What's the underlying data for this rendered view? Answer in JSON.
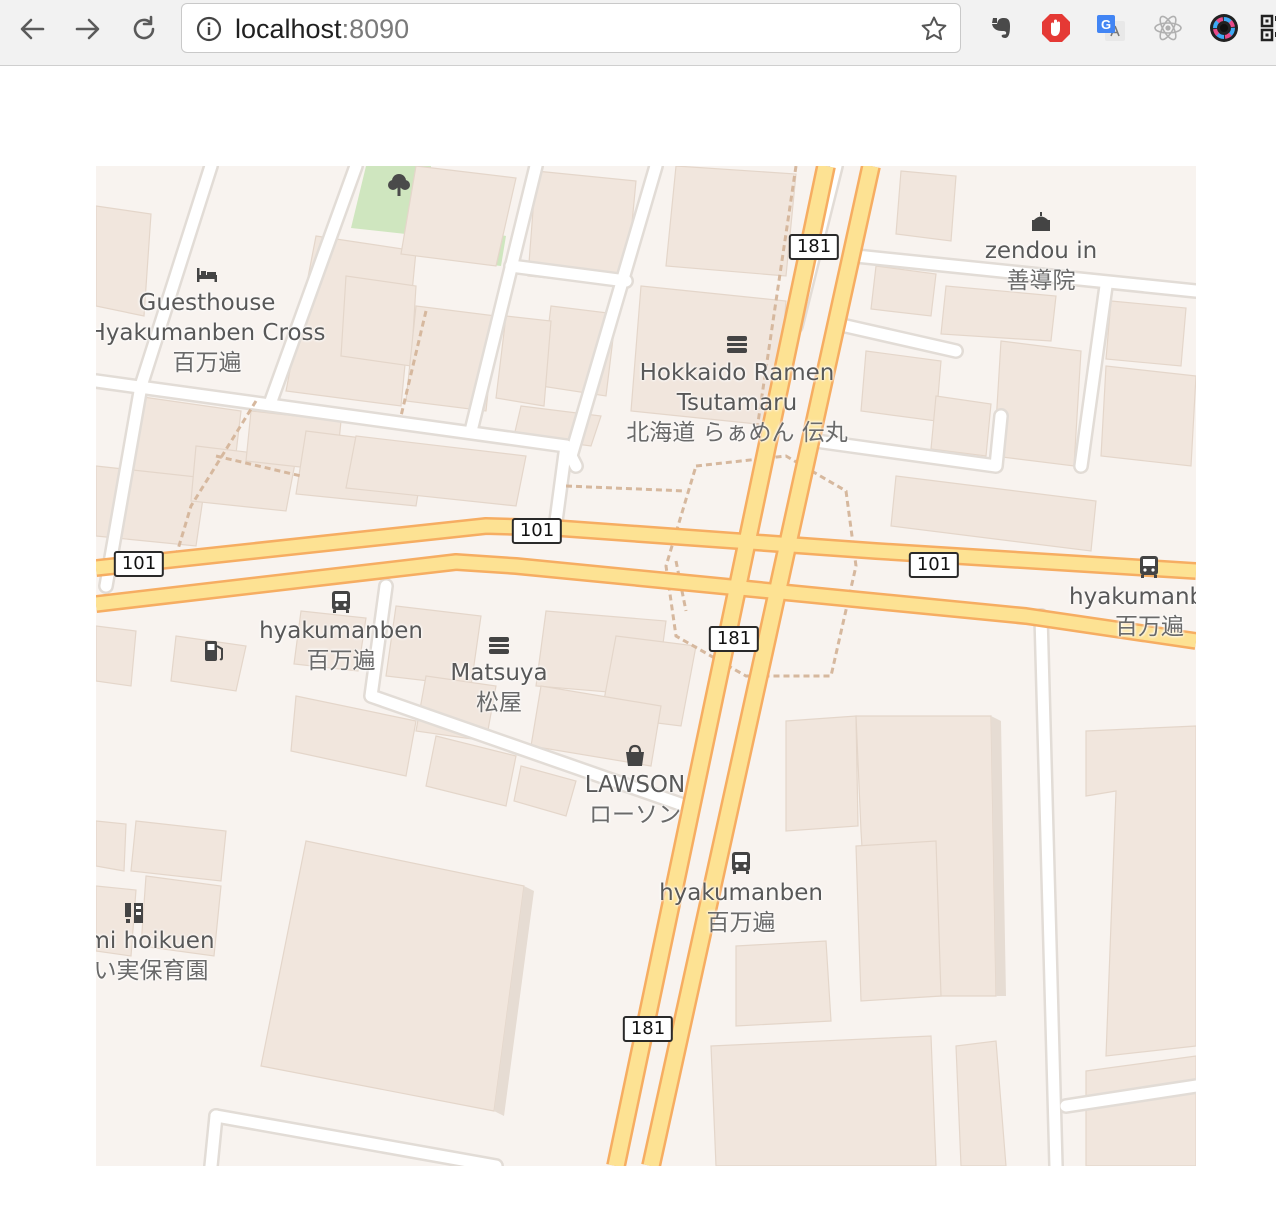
{
  "browser": {
    "url_host": "localhost",
    "url_port": ":8090",
    "icons": [
      "back-icon",
      "forward-icon",
      "reload-icon",
      "info-icon",
      "star-icon"
    ],
    "extensions": [
      "evernote-icon",
      "adblock-icon",
      "google-translate-icon",
      "react-devtools-icon",
      "color-picker-icon",
      "qr-code-icon"
    ]
  },
  "map": {
    "colors": {
      "land": "#f8f3ef",
      "building": "#f1e6dd",
      "park": "#cfe6bf",
      "road": "#ffffff",
      "road_casing": "#e2dcd6",
      "major_road": "#fde293",
      "major_road_casing": "#f6ad62",
      "path": "#d6b89e"
    },
    "route_shields": [
      {
        "id": "s1",
        "text": "181"
      },
      {
        "id": "s2",
        "text": "101"
      },
      {
        "id": "s3",
        "text": "101"
      },
      {
        "id": "s4",
        "text": "101"
      },
      {
        "id": "s5",
        "text": "181"
      },
      {
        "id": "s6",
        "text": "181"
      }
    ],
    "labels": {
      "guesthouse": {
        "name": "Guesthouse\nHyakumanben Cross",
        "local": "百万遍",
        "icon": "bed-icon"
      },
      "ramen": {
        "name": "Hokkaido Ramen\nTsutamaru",
        "local": "北海道 らぁめん 伝丸",
        "icon": "restaurant-icon"
      },
      "zendou": {
        "name": "zendou in",
        "local": "善導院",
        "icon": "temple-icon"
      },
      "bus_west": {
        "name": "hyakumanben",
        "local": "百万遍",
        "icon": "bus-icon"
      },
      "bus_east": {
        "name": "hyakumanb",
        "local": "百万遍",
        "icon": "bus-icon"
      },
      "bus_south": {
        "name": "hyakumanben",
        "local": "百万遍",
        "icon": "bus-icon"
      },
      "matsuya": {
        "name": "Matsuya",
        "local": "松屋",
        "icon": "restaurant-icon"
      },
      "lawson": {
        "name": "LAWSON",
        "local": "ローソン",
        "icon": "shop-icon"
      },
      "fuel": {
        "icon": "fuel-icon"
      },
      "hoikuen": {
        "name": "mi hoikuen",
        "local": "い実保育園",
        "icon": "school-icon"
      },
      "park": {
        "icon": "tree-icon"
      }
    }
  }
}
